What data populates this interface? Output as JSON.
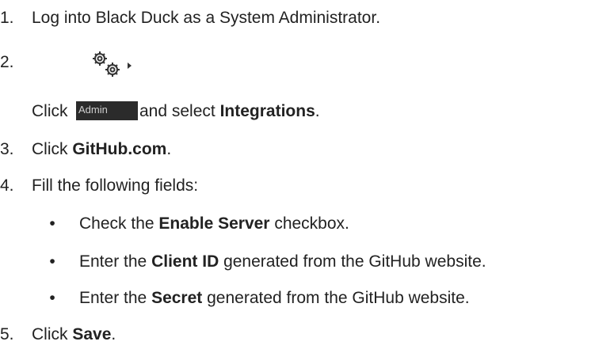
{
  "steps": [
    {
      "number": "1.",
      "text": "Log into Black Duck as a System Administrator."
    },
    {
      "number": "2.",
      "prefix": "Click ",
      "admin_label": "Admin",
      "middle": " and select ",
      "bold": "Integrations",
      "suffix": "."
    },
    {
      "number": "3.",
      "prefix": "Click ",
      "bold": "GitHub.com",
      "suffix": "."
    },
    {
      "number": "4.",
      "text": "Fill the following fields:"
    },
    {
      "number": "5.",
      "prefix": "Click ",
      "bold": "Save",
      "suffix": "."
    }
  ],
  "substeps": [
    {
      "bullet": "•",
      "prefix": "Check the ",
      "bold": "Enable Server",
      "suffix": " checkbox."
    },
    {
      "bullet": "•",
      "prefix": "Enter the ",
      "bold": "Client ID",
      "suffix": " generated from the GitHub website."
    },
    {
      "bullet": "•",
      "prefix": "Enter the ",
      "bold": "Secret",
      "suffix": " generated from the GitHub website."
    }
  ],
  "icons": {
    "admin_icon": "gears-icon",
    "caret": "caret-right-icon",
    "tile_color": "#2b2b2b"
  }
}
